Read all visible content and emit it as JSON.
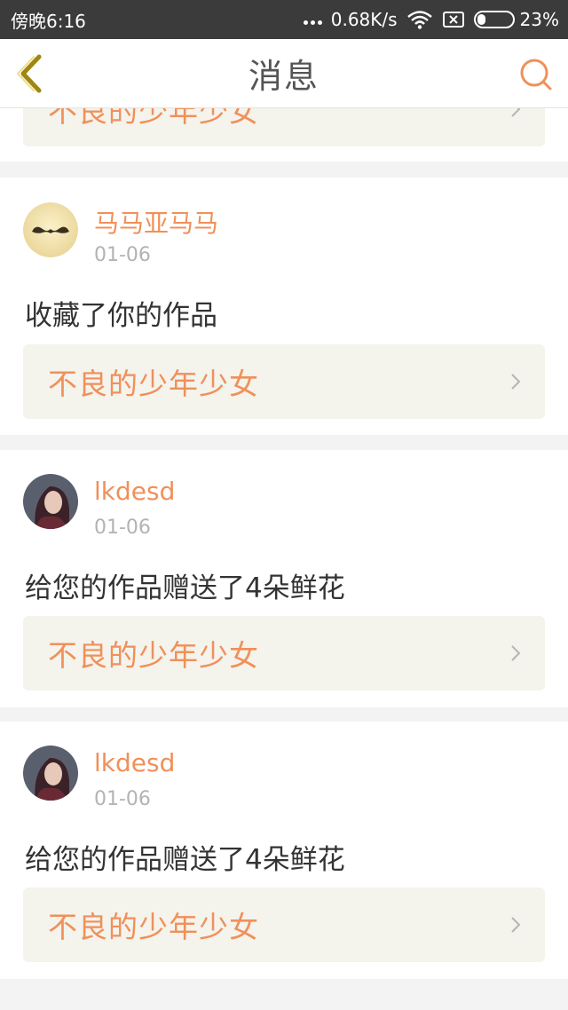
{
  "status": {
    "time": "傍晚6:16",
    "speed": "0.68K/s",
    "battery": "23%",
    "battery_level": 0.23,
    "icons": [
      "signal-dots-icon",
      "wifi-icon",
      "sim-icon",
      "battery-icon"
    ]
  },
  "nav": {
    "title": "消息",
    "back_icon": "chevron-left-icon",
    "search_icon": "search-icon"
  },
  "colors": {
    "accent": "#f0905a",
    "link_bg": "#f4f3ec",
    "page_bg": "#f3f3f3",
    "back_icon": "#a08612"
  },
  "partial_top_card": {
    "work_title": "不良的少年少女"
  },
  "messages": [
    {
      "user": "马马亚马马",
      "date": "01-06",
      "text": "收藏了你的作品",
      "work_title": "不良的少年少女",
      "avatar_icon": "mustache-avatar"
    },
    {
      "user": "lkdesd",
      "date": "01-06",
      "text": "给您的作品赠送了4朵鲜花",
      "work_title": "不良的少年少女",
      "avatar_icon": "portrait-avatar"
    },
    {
      "user": "lkdesd",
      "date": "01-06",
      "text": "给您的作品赠送了4朵鲜花",
      "work_title": "不良的少年少女",
      "avatar_icon": "portrait-avatar"
    }
  ]
}
